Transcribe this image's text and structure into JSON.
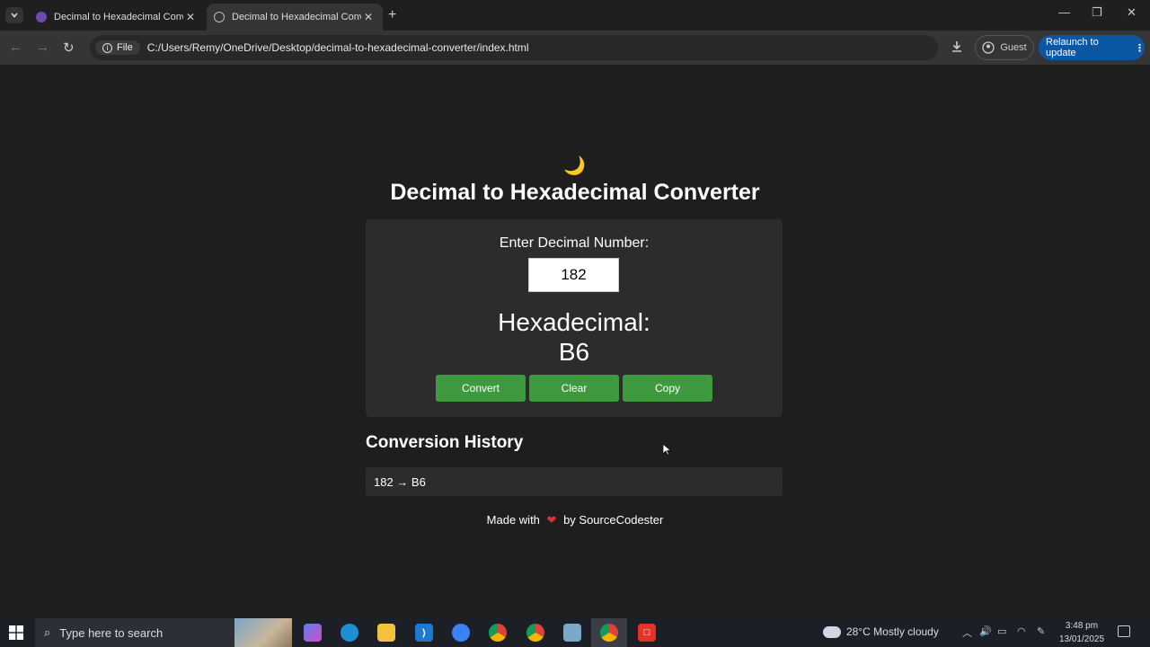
{
  "browser": {
    "tabs": [
      {
        "title": "Decimal to Hexadecimal Conver"
      },
      {
        "title": "Decimal to Hexadecimal Conve"
      }
    ],
    "chip_label": "File",
    "url": "C:/Users/Remy/OneDrive/Desktop/decimal-to-hexadecimal-converter/index.html",
    "guest_label": "Guest",
    "relaunch_label": "Relaunch to update"
  },
  "app": {
    "theme_icon": "🌙",
    "title": "Decimal to Hexadecimal Converter",
    "input_label": "Enter Decimal Number:",
    "input_value": "182",
    "result_label": "Hexadecimal:",
    "result_value": "B6",
    "buttons": {
      "convert": "Convert",
      "clear": "Clear",
      "copy": "Copy"
    },
    "history_title": "Conversion History",
    "history": [
      "182 → B6"
    ],
    "footer_before": "Made with",
    "footer_heart": "❤",
    "footer_after": "by SourceCodester",
    "accent_color": "#3f9a3f"
  },
  "taskbar": {
    "search_placeholder": "Type here to search",
    "weather": "28°C  Mostly cloudy",
    "time": "3:48 pm",
    "date": "13/01/2025"
  }
}
